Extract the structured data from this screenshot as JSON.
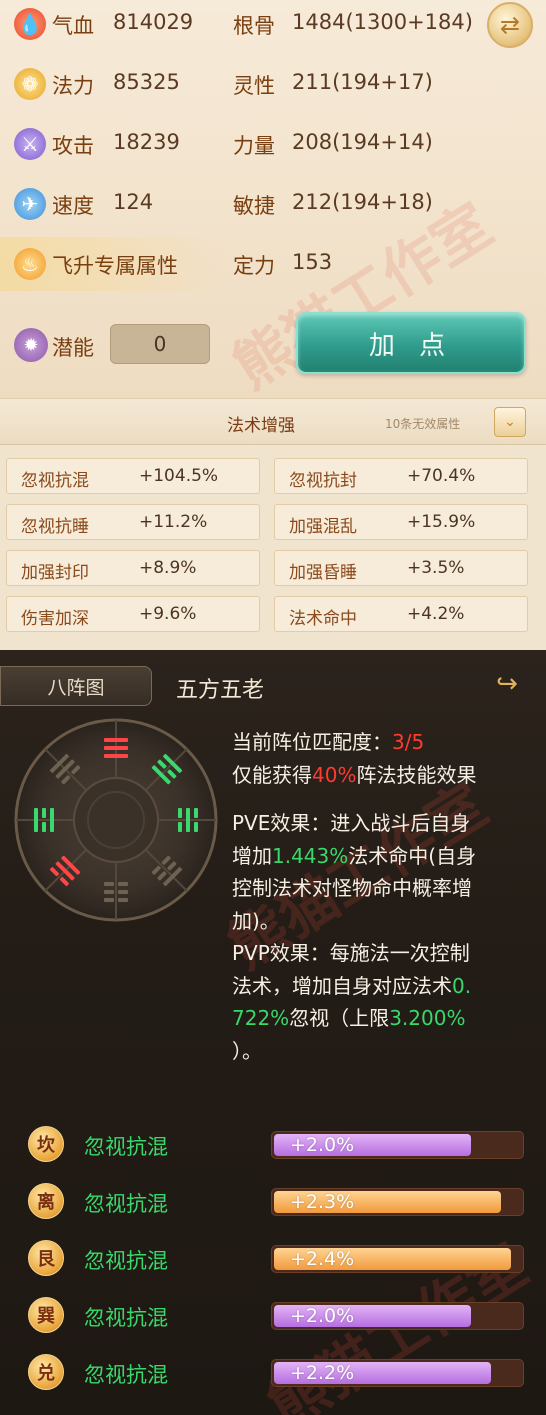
{
  "attributes": {
    "left": [
      {
        "label": "气血",
        "value": "814029",
        "icon": "blood-drop-icon"
      },
      {
        "label": "法力",
        "value": "85325",
        "icon": "mana-swirl-icon"
      },
      {
        "label": "攻击",
        "value": "18239",
        "icon": "sword-icon"
      },
      {
        "label": "速度",
        "value": "124",
        "icon": "boot-icon"
      }
    ],
    "right": [
      {
        "label": "根骨",
        "value": "1484(1300+184)"
      },
      {
        "label": "灵性",
        "value": "211(194+17)"
      },
      {
        "label": "力量",
        "value": "208(194+14)"
      },
      {
        "label": "敏捷",
        "value": "212(194+18)"
      },
      {
        "label": "定力",
        "value": "153"
      }
    ],
    "feisheng_label": "飞升专属属性",
    "qianneng_label": "潜能",
    "qianneng_value": "0",
    "add_point_label": "加 点"
  },
  "magic": {
    "title": "法术增强",
    "hint": "10条无效属性",
    "stats": [
      {
        "name": "忽视抗混",
        "value": "+104.5%"
      },
      {
        "name": "忽视抗封",
        "value": "+70.4%"
      },
      {
        "name": "忽视抗睡",
        "value": "+11.2%"
      },
      {
        "name": "加强混乱",
        "value": "+15.9%"
      },
      {
        "name": "加强封印",
        "value": "+8.9%"
      },
      {
        "name": "加强昏睡",
        "value": "+3.5%"
      },
      {
        "name": "伤害加深",
        "value": "+9.6%"
      },
      {
        "name": "法术命中",
        "value": "+4.2%"
      }
    ]
  },
  "formation": {
    "tab_label": "八阵图",
    "name": "五方五老",
    "match_label": "当前阵位匹配度：",
    "match_value": "3/5",
    "line2_pre": "仅能获得",
    "line2_pct": "40%",
    "line2_post": "阵法技能效果",
    "pve_1": "PVE效果：进入战斗后自身",
    "pve_2a": "增加",
    "pve_2b": "1.443%",
    "pve_2c": "法术命中(自身",
    "pve_3": "控制法术对怪物命中概率增",
    "pve_4": "加)。",
    "pvp_1": "PVP效果：每施法一次控制",
    "pvp_2a": "法术，增加自身对应法术",
    "pvp_2b": "0.",
    "pvp_3a": "722%",
    "pvp_3b": "忽视（上限",
    "pvp_3c": "3.200%",
    "pvp_4": "）。",
    "bars": [
      {
        "trigram": "坎",
        "label": "忽视抗混",
        "value": "+2.0%",
        "color": "purple",
        "level": 0.79
      },
      {
        "trigram": "离",
        "label": "忽视抗混",
        "value": "+2.3%",
        "color": "orange",
        "level": 0.91
      },
      {
        "trigram": "艮",
        "label": "忽视抗混",
        "value": "+2.4%",
        "color": "orange",
        "level": 0.95
      },
      {
        "trigram": "巽",
        "label": "忽视抗混",
        "value": "+2.0%",
        "color": "purple",
        "level": 0.79
      },
      {
        "trigram": "兑",
        "label": "忽视抗混",
        "value": "+2.2%",
        "color": "purple",
        "level": 0.87
      }
    ]
  }
}
